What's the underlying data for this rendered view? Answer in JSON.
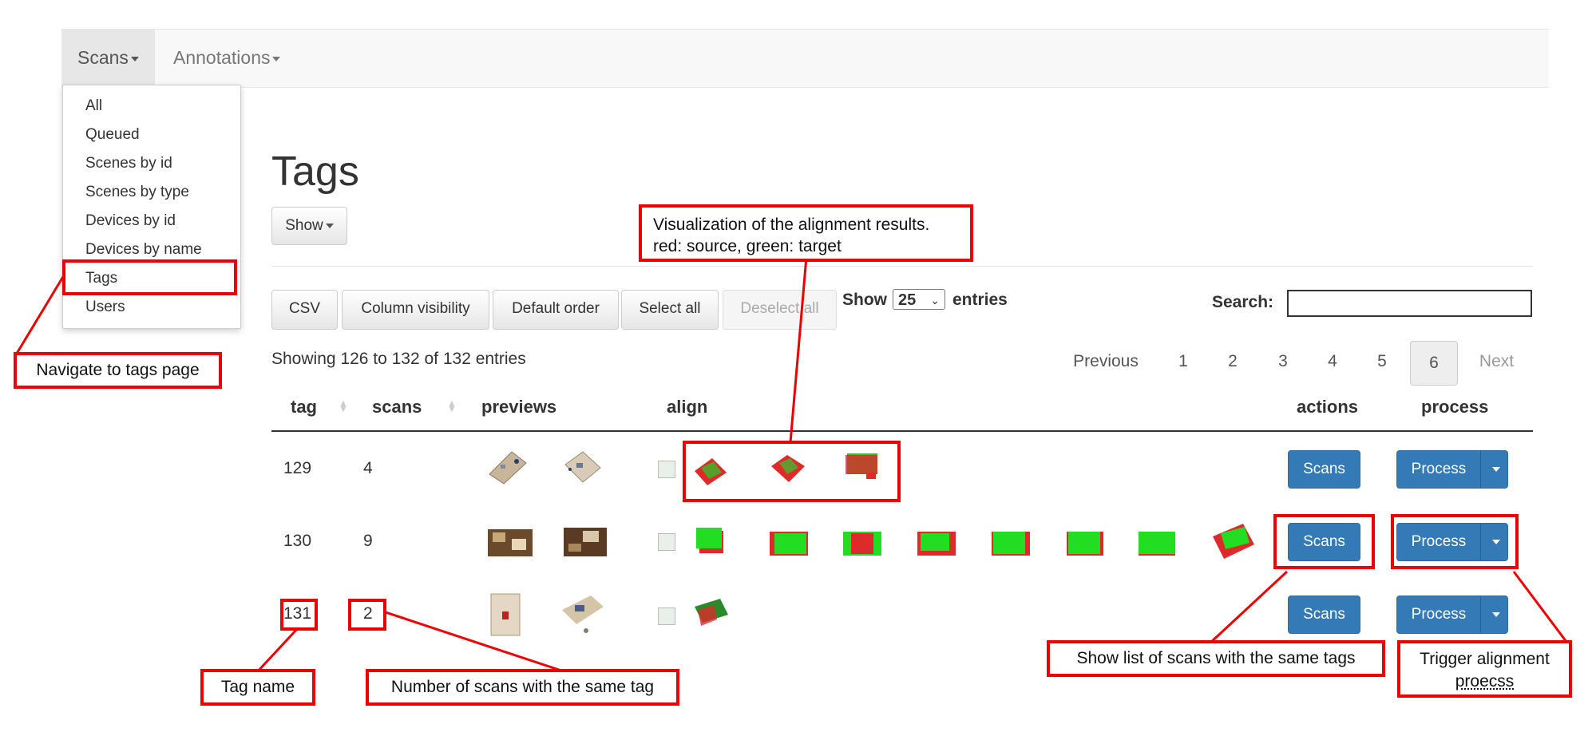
{
  "navbar": {
    "scans_menu": "Scans",
    "annotations_menu": "Annotations"
  },
  "dropdown": {
    "items": [
      "All",
      "Queued",
      "Scenes by id",
      "Scenes by type",
      "Devices by id",
      "Devices by name",
      "Tags",
      "Users"
    ]
  },
  "page": {
    "title": "Tags",
    "show_button": "Show"
  },
  "toolbar": {
    "csv": "CSV",
    "column_visibility": "Column visibility",
    "default_order": "Default order",
    "select_all": "Select all",
    "deselect_all": "Deselect all",
    "show_label": "Show",
    "entries_value": "25",
    "entries_label": "entries",
    "search_label": "Search:"
  },
  "table_info": "Showing 126 to 132 of 132 entries",
  "pagination": {
    "previous": "Previous",
    "pages": [
      "1",
      "2",
      "3",
      "4",
      "5",
      "6"
    ],
    "active_page": "6",
    "next": "Next"
  },
  "table": {
    "headers": {
      "tag": "tag",
      "scans": "scans",
      "previews": "previews",
      "align": "align",
      "actions": "actions",
      "process": "process"
    },
    "rows": [
      {
        "tag": "129",
        "scans": "4",
        "align_count": 3
      },
      {
        "tag": "130",
        "scans": "9",
        "align_count": 8
      },
      {
        "tag": "131",
        "scans": "2",
        "align_count": 1
      }
    ],
    "scans_button": "Scans",
    "process_button": "Process"
  },
  "annotations": {
    "navigate": "Navigate to tags page",
    "visualization_line1": "Visualization of the alignment results.",
    "visualization_line2": "red: source, green: target",
    "tag_name": "Tag name",
    "num_scans": "Number of scans with the same tag",
    "show_list": "Show list of scans with the same tags",
    "trigger_line1": "Trigger alignment",
    "trigger_line2": "proecss"
  },
  "colors": {
    "primary": "#337ab7",
    "annotation_red": "#ee0000",
    "source": "#ee2222",
    "target": "#22dd22"
  }
}
